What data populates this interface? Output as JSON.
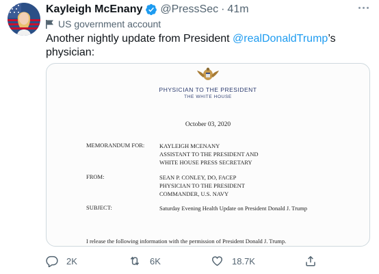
{
  "tweet": {
    "author_name": "Kayleigh McEnany",
    "handle": "@PressSec",
    "separator": "·",
    "time": "41m",
    "label": "US government account",
    "text_before": "Another nightly update from President ",
    "mention": "@realDonaldTrump",
    "text_after": "’s physician:",
    "icons": {
      "verified": "verified-badge-icon",
      "more": "more-icon",
      "gov": "flag-icon"
    },
    "colors": {
      "accent": "#1d9bf0",
      "secondary_text": "#536471"
    }
  },
  "document": {
    "header_title": "PHYSICIAN TO THE PRESIDENT",
    "header_subtitle": "THE WHITE HOUSE",
    "date": "October 03, 2020",
    "memo_label": "MEMORANDUM FOR:",
    "memo_lines": [
      "KAYLEIGH MCENANY",
      "ASSISTANT TO THE PRESIDENT AND",
      "WHITE HOUSE PRESS SECRETARY"
    ],
    "from_label": "FROM:",
    "from_lines": [
      "SEAN P. CONLEY, DO, FACEP",
      "PHYSICIAN TO THE PRESIDENT",
      "COMMANDER, U.S. NAVY"
    ],
    "subject_label": "SUBJECT:",
    "subject_value": "Saturday Evening Health Update on President Donald J. Trump",
    "footer_line": "I release the following information with the permission of President Donald J. Trump."
  },
  "actions": {
    "reply_count": "2K",
    "retweet_count": "6K",
    "like_count": "18.7K"
  }
}
